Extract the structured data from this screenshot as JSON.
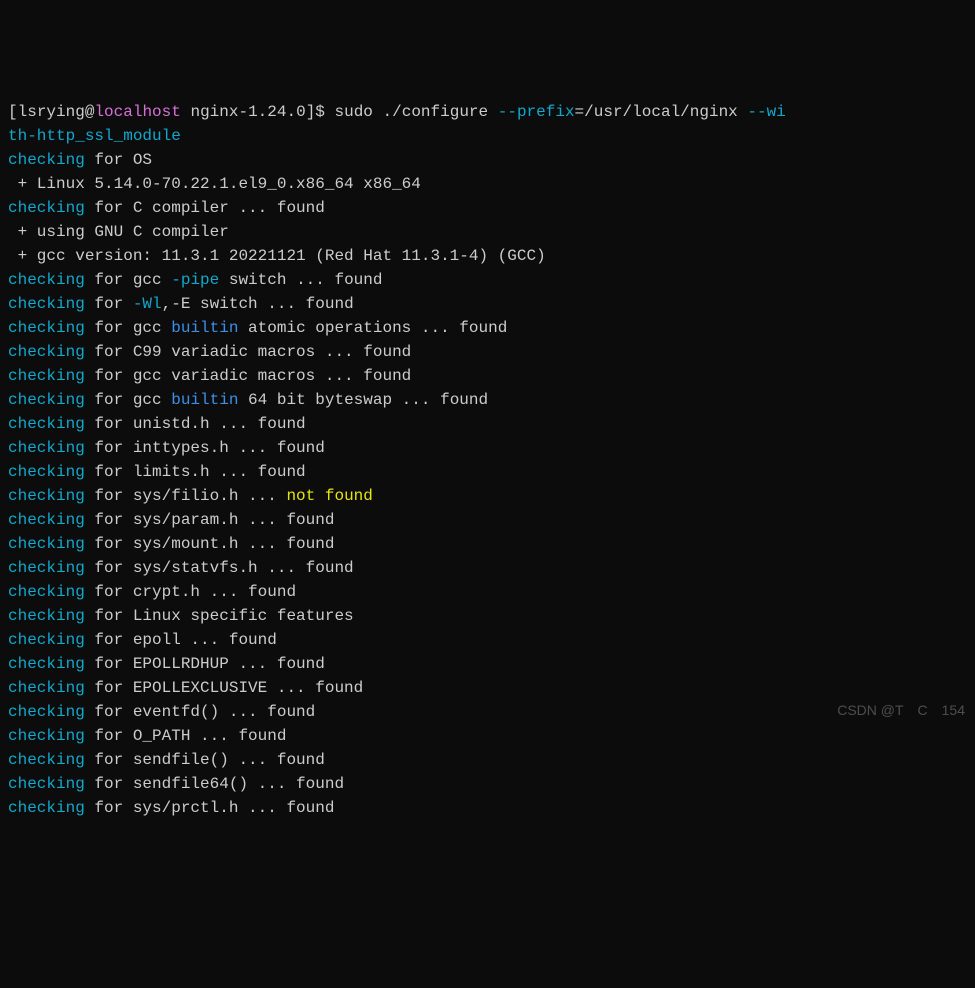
{
  "prompt": {
    "open": "[",
    "user": "lsrying",
    "at": "@",
    "host": "localhost",
    "space": " ",
    "dir": "nginx-1.24.0",
    "close": "]$ ",
    "cmd1": "sudo ./configure ",
    "flag_prefix": "--prefix",
    "eq_path": "=/usr/local/nginx ",
    "flag_wi": "--wi",
    "line2": "th-http_ssl_module"
  },
  "lines": [
    {
      "type": "check",
      "target": "for OS"
    },
    {
      "type": "plain",
      "text": " + Linux 5.14.0-70.22.1.el9_0.x86_64 x86_64"
    },
    {
      "type": "check",
      "target": "for C compiler ... found"
    },
    {
      "type": "plain",
      "text": " + using GNU C compiler"
    },
    {
      "type": "plain",
      "text": " + gcc version: 11.3.1 20221121 (Red Hat 11.3.1-4) (GCC)"
    },
    {
      "type": "check_flag",
      "pre": "for gcc ",
      "flag": "-pipe",
      "post": " switch ... found"
    },
    {
      "type": "check_flag",
      "pre": "for ",
      "flag": "-Wl",
      "post": ",-E switch ... found"
    },
    {
      "type": "check_builtin",
      "pre": "for gcc ",
      "kw": "builtin",
      "post": " atomic operations ... found"
    },
    {
      "type": "check",
      "target": "for C99 variadic macros ... found"
    },
    {
      "type": "check",
      "target": "for gcc variadic macros ... found"
    },
    {
      "type": "check_builtin",
      "pre": "for gcc ",
      "kw": "builtin",
      "post": " 64 bit byteswap ... found"
    },
    {
      "type": "check",
      "target": "for unistd.h ... found"
    },
    {
      "type": "check",
      "target": "for inttypes.h ... found"
    },
    {
      "type": "check",
      "target": "for limits.h ... found"
    },
    {
      "type": "check_notfound",
      "pre": "for sys/filio.h ... ",
      "nf": "not found"
    },
    {
      "type": "check",
      "target": "for sys/param.h ... found"
    },
    {
      "type": "check",
      "target": "for sys/mount.h ... found"
    },
    {
      "type": "check",
      "target": "for sys/statvfs.h ... found"
    },
    {
      "type": "check",
      "target": "for crypt.h ... found"
    },
    {
      "type": "check",
      "target": "for Linux specific features"
    },
    {
      "type": "check",
      "target": "for epoll ... found"
    },
    {
      "type": "check",
      "target": "for EPOLLRDHUP ... found"
    },
    {
      "type": "check",
      "target": "for EPOLLEXCLUSIVE ... found"
    },
    {
      "type": "check",
      "target": "for eventfd() ... found"
    },
    {
      "type": "check",
      "target": "for O_PATH ... found"
    },
    {
      "type": "check",
      "target": "for sendfile() ... found"
    },
    {
      "type": "check",
      "target": "for sendfile64() ... found"
    },
    {
      "type": "check",
      "target": "for sys/prctl.h ... found"
    }
  ],
  "tokens": {
    "checking": "checking"
  },
  "watermark": "CSDN @T C 154"
}
